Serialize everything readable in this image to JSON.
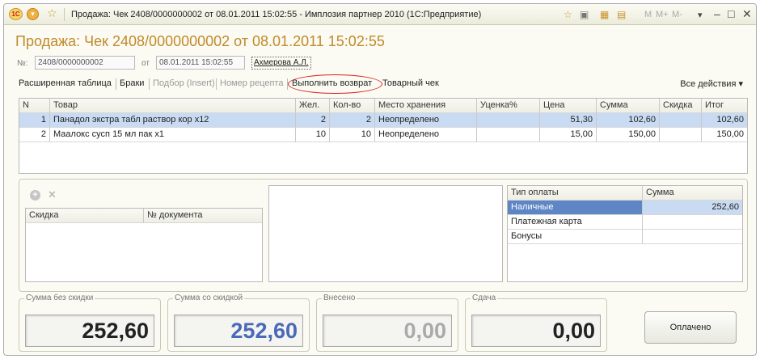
{
  "window": {
    "title": "Продажа: Чек 2408/0000000002 от 08.01.2011 15:02:55 - Имплозия партнер 2010 (1С:Предприятие)",
    "logo_text": "1С",
    "menu_glyph": "▾",
    "star_glyph": "☆",
    "toolbar_m_labels": [
      "M",
      "M+",
      "M-"
    ],
    "ctl_glyphs": {
      "dropdown": "▾",
      "minimize": "–",
      "maximize": "□",
      "close": "✕"
    }
  },
  "document": {
    "title": "Продажа: Чек 2408/0000000002 от 08.01.2011 15:02:55",
    "number_label": "№:",
    "number_value": "2408/0000000002",
    "date_label": "от",
    "date_value": "08.01.2011 15:02:55",
    "user": "Ахмерова А.Л."
  },
  "commands": {
    "extended_table": "Расширенная таблица",
    "defects": "Браки",
    "selection": "Подбор (Insert)",
    "recipe_number": "Номер рецепта",
    "do_return": "Выполнить возврат",
    "goods_check": "Товарный чек",
    "all_actions": "Все действия ▾"
  },
  "items_table": {
    "headers": [
      "N",
      "Товар",
      "Жел.",
      "Кол-во",
      "Место хранения",
      "Уценка%",
      "Цена",
      "Сумма",
      "Скидка",
      "Итог"
    ],
    "rows": [
      [
        "1",
        "Панадол экстра табл раствор кор х12",
        "2",
        "2",
        "Неопределено",
        "",
        "51,30",
        "102,60",
        "",
        "102,60"
      ],
      [
        "2",
        "Маалокс сусп 15 мл пак х1",
        "10",
        "10",
        "Неопределено",
        "",
        "15,00",
        "150,00",
        "",
        "150,00"
      ]
    ]
  },
  "discounts": {
    "headers": [
      "Скидка",
      "№ документа"
    ]
  },
  "payments": {
    "headers": [
      "Тип оплаты",
      "Сумма"
    ],
    "rows": [
      [
        "Наличные",
        "252,60"
      ],
      [
        "Платежная карта",
        ""
      ],
      [
        "Бонусы",
        ""
      ]
    ]
  },
  "totals": {
    "without_discount_label": "Сумма без скидки",
    "without_discount": "252,60",
    "with_discount_label": "Сумма со скидкой",
    "with_discount": "252,60",
    "paid_in_label": "Внесено",
    "paid_in": "0,00",
    "change_label": "Сдача",
    "change": "0,00",
    "paid_button": "Оплачено"
  },
  "colors": {
    "title_accent": "#c08a2a",
    "selection_row": "#c9dbf2",
    "selected_cell": "#5e86c5",
    "with_discount_text": "#4a6ab8",
    "circle": "#d82020"
  }
}
